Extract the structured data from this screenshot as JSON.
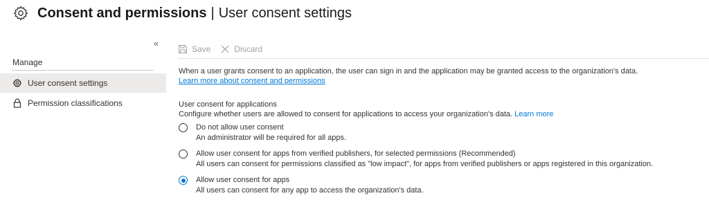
{
  "header": {
    "title": "Consent and permissions",
    "separator": "|",
    "subtitle": "User consent settings",
    "icon": "gear-icon"
  },
  "sidebar": {
    "collapse_glyph": "«",
    "section_label": "Manage",
    "items": [
      {
        "label": "User consent settings",
        "icon": "gear-icon",
        "active": true
      },
      {
        "label": "Permission classifications",
        "icon": "lock-icon",
        "active": false
      }
    ]
  },
  "toolbar": {
    "save_label": "Save",
    "discard_label": "Discard"
  },
  "content": {
    "intro_text": "When a user grants consent to an application, the user can sign in and the application may be granted access to the organization's data.",
    "intro_link": "Learn more about consent and permissions",
    "section_label": "User consent for applications",
    "section_desc": "Configure whether users are allowed to consent for applications to access your organization's data.",
    "section_link": "Learn more",
    "options": [
      {
        "title": "Do not allow user consent",
        "desc": "An administrator will be required for all apps.",
        "checked": false
      },
      {
        "title": "Allow user consent for apps from verified publishers, for selected permissions (Recommended)",
        "desc": "All users can consent for permissions classified as \"low impact\", for apps from verified publishers or apps registered in this organization.",
        "checked": false
      },
      {
        "title": "Allow user consent for apps",
        "desc": "All users can consent for any app to access the organization's data.",
        "checked": true
      }
    ]
  },
  "colors": {
    "accent": "#0078d4",
    "text": "#323130",
    "disabled": "#a19f9d",
    "active_nav_bg": "#edebe9"
  }
}
